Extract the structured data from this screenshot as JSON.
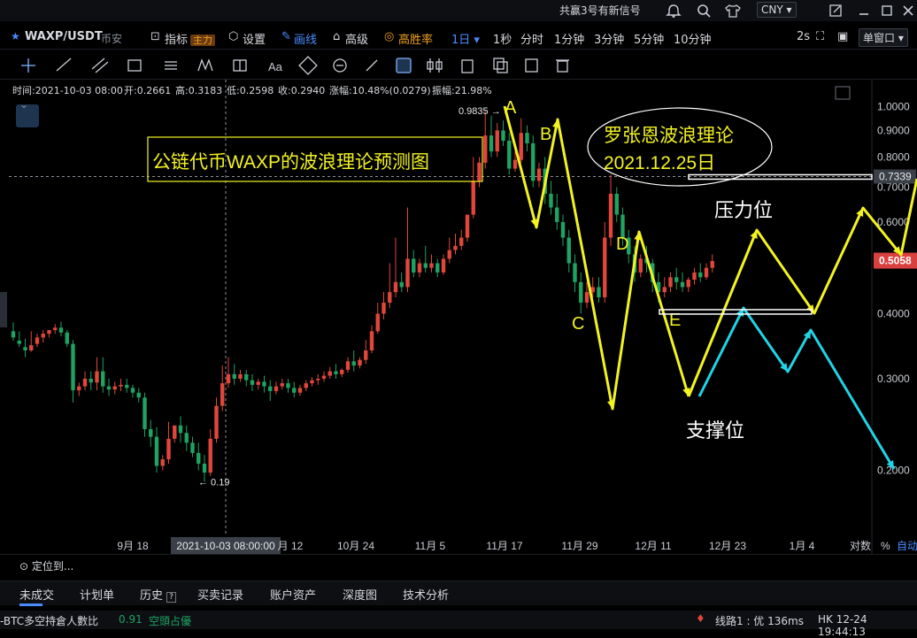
{
  "topbar": {
    "promo": "共赢3号有新信号",
    "currency": "CNY"
  },
  "toolbar": {
    "symbol": "WAXP/USDT",
    "exchange": "币安",
    "indicator": "指标",
    "indicator_tag": "主力",
    "settings": "设置",
    "draw": "画线",
    "advanced": "高级",
    "win_rate": "高胜率",
    "period_selected": "1日",
    "periods": [
      "1秒",
      "分时",
      "1分钟",
      "3分钟",
      "5分钟",
      "10分钟"
    ],
    "refresh": "2s",
    "window_mode": "单窗口"
  },
  "info_bar": {
    "time": "时间:2021-10-03 08:00",
    "open": "开:0.2661",
    "high": "高:0.3183",
    "low": "低:0.2598",
    "close": "收:0.2940",
    "change": "涨幅:10.48%(0.0279)",
    "amplitude": "振幅:21.98%"
  },
  "chart_data": {
    "type": "candlestick",
    "symbol": "WAXP/USDT",
    "interval": "1D",
    "yaxis": {
      "ticks": [
        1.0,
        0.9,
        0.8,
        0.7,
        0.6,
        0.5,
        0.4,
        0.3,
        0.2
      ],
      "ylim": [
        0.15,
        1.05
      ],
      "scale": "log"
    },
    "xaxis": {
      "ticks": [
        "9月 18",
        "10月 12",
        "10月 24",
        "11月 5",
        "11月 17",
        "11月 29",
        "12月 11",
        "12月 23",
        "1月 4"
      ],
      "crosshair_label": "2021-10-03 08:00:00"
    },
    "price_tag_current": 0.5058,
    "price_tag_crosshair": 0.7339,
    "max_label": "0.9835",
    "min_label": "0.19",
    "axis_mode": [
      "对数",
      "%",
      "自动"
    ],
    "candles": [
      [
        0.37,
        0.385,
        0.36,
        0.355
      ],
      [
        0.355,
        0.37,
        0.35,
        0.345
      ],
      [
        0.345,
        0.358,
        0.34,
        0.33
      ],
      [
        0.34,
        0.37,
        0.348,
        0.338
      ],
      [
        0.35,
        0.366,
        0.36,
        0.345
      ],
      [
        0.36,
        0.372,
        0.366,
        0.352
      ],
      [
        0.366,
        0.372,
        0.372,
        0.36
      ],
      [
        0.372,
        0.382,
        0.376,
        0.366
      ],
      [
        0.376,
        0.386,
        0.368,
        0.362
      ],
      [
        0.368,
        0.372,
        0.35,
        0.345
      ],
      [
        0.35,
        0.356,
        0.285,
        0.27
      ],
      [
        0.285,
        0.295,
        0.29,
        0.278
      ],
      [
        0.29,
        0.31,
        0.3,
        0.285
      ],
      [
        0.3,
        0.31,
        0.295,
        0.285
      ],
      [
        0.295,
        0.33,
        0.31,
        0.285
      ],
      [
        0.31,
        0.33,
        0.29,
        0.282
      ],
      [
        0.29,
        0.3,
        0.286,
        0.278
      ],
      [
        0.286,
        0.296,
        0.29,
        0.28
      ],
      [
        0.29,
        0.3,
        0.292,
        0.284
      ],
      [
        0.292,
        0.3,
        0.288,
        0.282
      ],
      [
        0.288,
        0.292,
        0.282,
        0.276
      ],
      [
        0.282,
        0.288,
        0.276,
        0.27
      ],
      [
        0.276,
        0.282,
        0.24,
        0.232
      ],
      [
        0.24,
        0.25,
        0.232,
        0.222
      ],
      [
        0.232,
        0.242,
        0.204,
        0.198
      ],
      [
        0.204,
        0.214,
        0.21,
        0.2
      ],
      [
        0.21,
        0.248,
        0.23,
        0.206
      ],
      [
        0.23,
        0.24,
        0.244,
        0.226
      ],
      [
        0.244,
        0.254,
        0.236,
        0.226
      ],
      [
        0.236,
        0.244,
        0.226,
        0.218
      ],
      [
        0.226,
        0.232,
        0.216,
        0.212
      ],
      [
        0.216,
        0.226,
        0.206,
        0.2
      ],
      [
        0.206,
        0.214,
        0.198,
        0.19
      ],
      [
        0.198,
        0.24,
        0.23,
        0.195
      ],
      [
        0.23,
        0.276,
        0.266,
        0.226
      ],
      [
        0.266,
        0.318,
        0.294,
        0.26
      ],
      [
        0.294,
        0.33,
        0.306,
        0.288
      ],
      [
        0.306,
        0.32,
        0.3,
        0.292
      ],
      [
        0.3,
        0.312,
        0.306,
        0.296
      ],
      [
        0.306,
        0.312,
        0.298,
        0.29
      ],
      [
        0.298,
        0.306,
        0.292,
        0.284
      ],
      [
        0.292,
        0.3,
        0.296,
        0.286
      ],
      [
        0.296,
        0.304,
        0.29,
        0.282
      ],
      [
        0.29,
        0.298,
        0.284,
        0.272
      ],
      [
        0.284,
        0.296,
        0.29,
        0.28
      ],
      [
        0.29,
        0.3,
        0.294,
        0.286
      ],
      [
        0.294,
        0.3,
        0.288,
        0.282
      ],
      [
        0.288,
        0.296,
        0.282,
        0.276
      ],
      [
        0.282,
        0.292,
        0.288,
        0.278
      ],
      [
        0.288,
        0.298,
        0.294,
        0.284
      ],
      [
        0.294,
        0.302,
        0.298,
        0.29
      ],
      [
        0.298,
        0.306,
        0.3,
        0.292
      ],
      [
        0.3,
        0.31,
        0.304,
        0.296
      ],
      [
        0.304,
        0.316,
        0.31,
        0.3
      ],
      [
        0.31,
        0.32,
        0.306,
        0.3
      ],
      [
        0.306,
        0.314,
        0.312,
        0.302
      ],
      [
        0.312,
        0.33,
        0.324,
        0.308
      ],
      [
        0.324,
        0.34,
        0.318,
        0.31
      ],
      [
        0.318,
        0.33,
        0.326,
        0.314
      ],
      [
        0.326,
        0.356,
        0.34,
        0.32
      ],
      [
        0.34,
        0.38,
        0.37,
        0.336
      ],
      [
        0.37,
        0.42,
        0.4,
        0.366
      ],
      [
        0.4,
        0.44,
        0.42,
        0.39
      ],
      [
        0.42,
        0.5,
        0.44,
        0.41
      ],
      [
        0.44,
        0.56,
        0.46,
        0.43
      ],
      [
        0.46,
        0.48,
        0.45,
        0.44
      ],
      [
        0.45,
        0.64,
        0.51,
        0.44
      ],
      [
        0.51,
        0.53,
        0.48,
        0.47
      ],
      [
        0.48,
        0.51,
        0.5,
        0.47
      ],
      [
        0.5,
        0.54,
        0.49,
        0.48
      ],
      [
        0.49,
        0.52,
        0.5,
        0.48
      ],
      [
        0.5,
        0.51,
        0.48,
        0.47
      ],
      [
        0.48,
        0.52,
        0.51,
        0.475
      ],
      [
        0.51,
        0.56,
        0.53,
        0.5
      ],
      [
        0.53,
        0.57,
        0.54,
        0.52
      ],
      [
        0.54,
        0.58,
        0.56,
        0.53
      ],
      [
        0.56,
        0.6,
        0.62,
        0.55
      ],
      [
        0.62,
        0.8,
        0.72,
        0.61
      ],
      [
        0.72,
        0.8,
        0.78,
        0.7
      ],
      [
        0.78,
        0.983,
        0.88,
        0.76
      ],
      [
        0.88,
        0.96,
        0.82,
        0.8
      ],
      [
        0.82,
        0.93,
        0.9,
        0.8
      ],
      [
        0.9,
        0.94,
        0.86,
        0.84
      ],
      [
        0.86,
        0.89,
        0.76,
        0.74
      ],
      [
        0.76,
        0.82,
        0.79,
        0.75
      ],
      [
        0.79,
        0.95,
        0.89,
        0.78
      ],
      [
        0.89,
        0.92,
        0.85,
        0.82
      ],
      [
        0.85,
        0.88,
        0.72,
        0.7
      ],
      [
        0.72,
        0.78,
        0.76,
        0.7
      ],
      [
        0.76,
        0.8,
        0.68,
        0.65
      ],
      [
        0.68,
        0.72,
        0.64,
        0.62
      ],
      [
        0.64,
        0.68,
        0.6,
        0.58
      ],
      [
        0.6,
        0.62,
        0.56,
        0.54
      ],
      [
        0.56,
        0.58,
        0.5,
        0.48
      ],
      [
        0.5,
        0.52,
        0.46,
        0.44
      ],
      [
        0.46,
        0.48,
        0.42,
        0.4
      ],
      [
        0.42,
        0.46,
        0.44,
        0.41
      ],
      [
        0.44,
        0.47,
        0.45,
        0.43
      ],
      [
        0.45,
        0.47,
        0.43,
        0.42
      ],
      [
        0.43,
        0.6,
        0.56,
        0.42
      ],
      [
        0.56,
        0.74,
        0.68,
        0.54
      ],
      [
        0.68,
        0.7,
        0.62,
        0.6
      ],
      [
        0.62,
        0.64,
        0.56,
        0.54
      ],
      [
        0.56,
        0.58,
        0.52,
        0.5
      ],
      [
        0.52,
        0.54,
        0.48,
        0.46
      ],
      [
        0.48,
        0.52,
        0.51,
        0.47
      ],
      [
        0.51,
        0.54,
        0.5,
        0.48
      ],
      [
        0.5,
        0.51,
        0.46,
        0.44
      ],
      [
        0.46,
        0.48,
        0.44,
        0.42
      ],
      [
        0.44,
        0.47,
        0.45,
        0.43
      ],
      [
        0.45,
        0.48,
        0.47,
        0.44
      ],
      [
        0.47,
        0.49,
        0.46,
        0.445
      ],
      [
        0.46,
        0.48,
        0.45,
        0.44
      ],
      [
        0.45,
        0.47,
        0.465,
        0.44
      ],
      [
        0.465,
        0.49,
        0.48,
        0.455
      ],
      [
        0.48,
        0.5,
        0.47,
        0.46
      ],
      [
        0.47,
        0.5,
        0.49,
        0.465
      ],
      [
        0.49,
        0.52,
        0.505,
        0.48
      ]
    ],
    "wave_labels": [
      "A",
      "B",
      "C",
      "D",
      "E"
    ],
    "annotations": {
      "title_box": "公链代币WAXP的波浪理论预测图",
      "ellipse_line1": "罗张恩波浪理论",
      "ellipse_line2": "2021.12.25日",
      "resistance": "压力位",
      "support": "支撑位"
    }
  },
  "bottom": {
    "locate": "定位到...",
    "tabs": [
      "未成交",
      "计划单",
      "历史",
      "买卖记录",
      "账户资产",
      "深度图",
      "技术分析"
    ]
  },
  "status": {
    "left_label": "-BTC多空持倉人數比",
    "ratio": "0.91",
    "ratio_text": "空頭占優",
    "line": "线路1 : 优 136ms",
    "clock": "HK 12-24 19:44:13"
  },
  "colors": {
    "up": "#e0463c",
    "down": "#1ea362",
    "yellow": "#f3f322",
    "cyan": "#22d3e6",
    "price_tag": "#d94040",
    "accent": "#4a8cff"
  }
}
